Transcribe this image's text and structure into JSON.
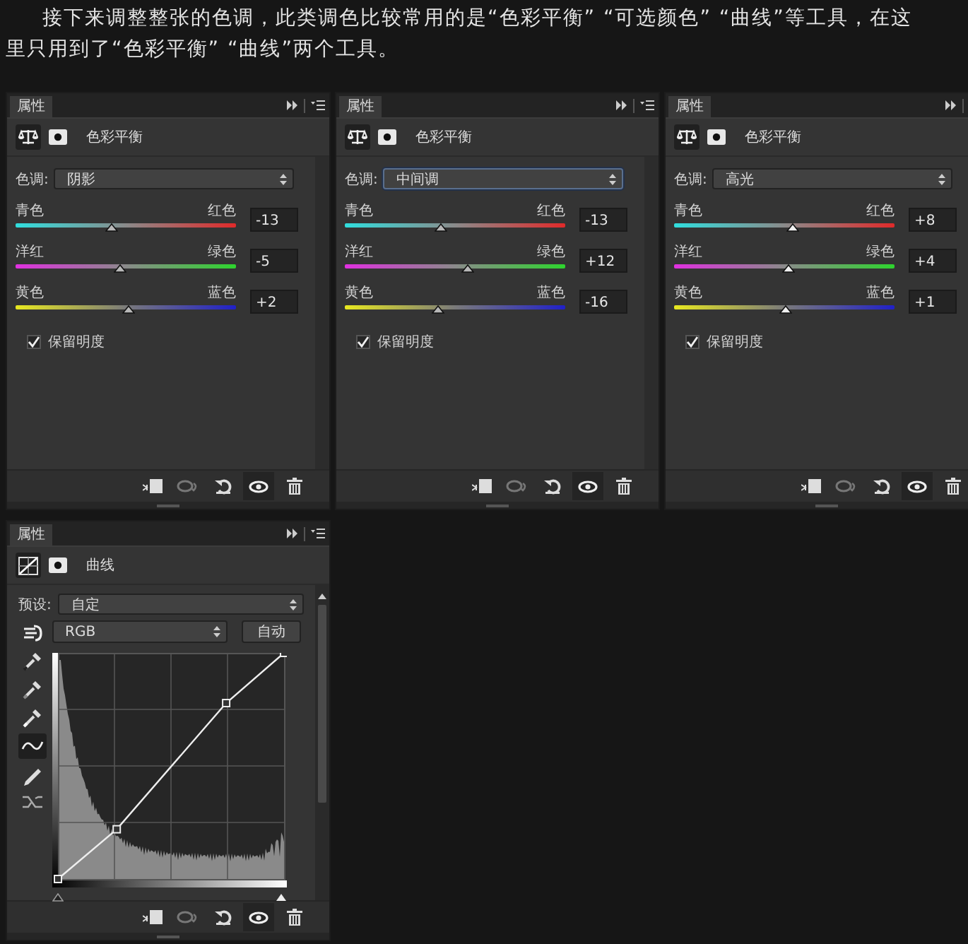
{
  "intro": "接下来调整整张的色调，此类调色比较常用的是“色彩平衡” “可选颜色” “曲线”等工具，在这里只用到了“色彩平衡” “曲线”两个工具。",
  "color_balance_panels": [
    {
      "tab": "属性",
      "title": "色彩平衡",
      "tone_label": "色调:",
      "tone": "阴影",
      "visible": true,
      "sliders": [
        {
          "left": "青色",
          "right": "红色",
          "level": 0.435,
          "value": "-13"
        },
        {
          "left": "洋红",
          "right": "绿色",
          "level": 0.475,
          "value": "-5"
        },
        {
          "left": "黄色",
          "right": "蓝色",
          "level": 0.51,
          "value": "+2"
        }
      ],
      "preserve": {
        "label": "保留明度",
        "checked": true
      }
    },
    {
      "tab": "属性",
      "title": "色彩平衡",
      "tone_label": "色调:",
      "tone": "中间调",
      "visible": true,
      "sliders": [
        {
          "left": "青色",
          "right": "红色",
          "level": 0.435,
          "value": "-13"
        },
        {
          "left": "洋红",
          "right": "绿色",
          "level": 0.56,
          "value": "+12"
        },
        {
          "left": "黄色",
          "right": "蓝色",
          "level": 0.42,
          "value": "-16"
        }
      ],
      "preserve": {
        "label": "保留明度",
        "checked": true
      }
    },
    {
      "tab": "属性",
      "title": "色彩平衡",
      "tone_label": "色调:",
      "tone": "高光",
      "visible": true,
      "sliders": [
        {
          "left": "青色",
          "right": "红色",
          "level": 0.54,
          "value": "+8"
        },
        {
          "left": "洋红",
          "right": "绿色",
          "level": 0.52,
          "value": "+4"
        },
        {
          "left": "黄色",
          "right": "蓝色",
          "level": 0.505,
          "value": "+1"
        }
      ],
      "preserve": {
        "label": "保留明度",
        "checked": true
      }
    }
  ],
  "curves_panel": {
    "tab": "属性",
    "title": "曲线",
    "preset_label": "预设:",
    "preset": "自定",
    "channel": "RGB",
    "auto_button": "自动",
    "visible": true,
    "tools": [
      {
        "kind": "hand",
        "selected": false
      },
      {
        "kind": "black-eyedropper",
        "selected": false
      },
      {
        "kind": "gray-eyedropper",
        "selected": false
      },
      {
        "kind": "white-eyedropper",
        "selected": false
      },
      {
        "kind": "curve",
        "selected": true
      },
      {
        "kind": "pencil",
        "selected": false
      },
      {
        "kind": "smooth",
        "selected": false
      }
    ]
  }
}
